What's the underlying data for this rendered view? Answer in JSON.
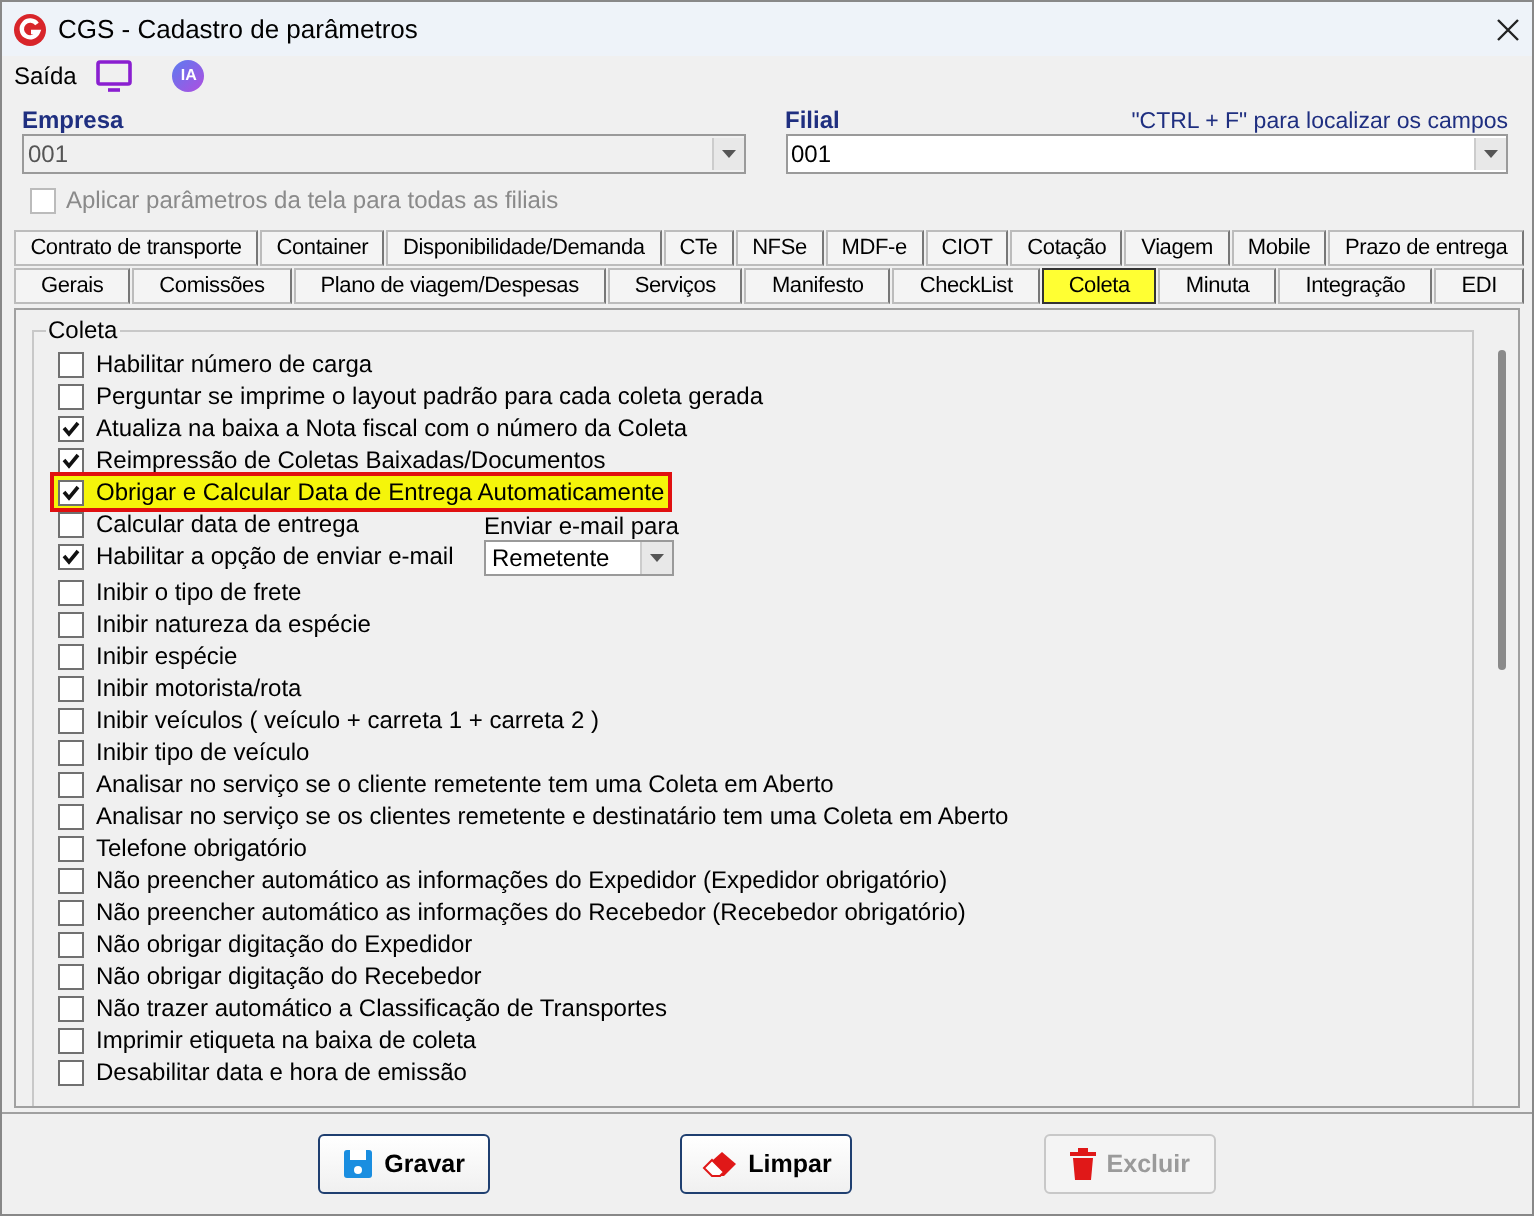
{
  "window": {
    "title": "CGS - Cadastro de parâmetros"
  },
  "toolbar": {
    "label": "Saída",
    "ia_badge": "IA"
  },
  "empresa": {
    "label": "Empresa",
    "value": "001",
    "disabled": true
  },
  "filial": {
    "label": "Filial",
    "value": "001",
    "disabled": false,
    "hint": "\"CTRL + F\" para localizar os campos"
  },
  "apply_all": {
    "label": "Aplicar parâmetros da tela para todas as filiais",
    "checked": false,
    "disabled": true
  },
  "tab_rows": [
    [
      {
        "label": "Contrato de transporte",
        "selected": false
      },
      {
        "label": "Container",
        "selected": false
      },
      {
        "label": "Disponibilidade/Demanda",
        "selected": false
      },
      {
        "label": "CTe",
        "selected": false
      },
      {
        "label": "NFSe",
        "selected": false
      },
      {
        "label": "MDF-e",
        "selected": false
      },
      {
        "label": "CIOT",
        "selected": false
      },
      {
        "label": "Cotação",
        "selected": false
      },
      {
        "label": "Viagem",
        "selected": false
      },
      {
        "label": "Mobile",
        "selected": false
      },
      {
        "label": "Prazo de entrega",
        "selected": false
      }
    ],
    [
      {
        "label": "Gerais",
        "selected": false
      },
      {
        "label": "Comissões",
        "selected": false
      },
      {
        "label": "Plano de viagem/Despesas",
        "selected": false
      },
      {
        "label": "Serviços",
        "selected": false
      },
      {
        "label": "Manifesto",
        "selected": false
      },
      {
        "label": "CheckList",
        "selected": false
      },
      {
        "label": "Coleta",
        "selected": true
      },
      {
        "label": "Minuta",
        "selected": false
      },
      {
        "label": "Integração",
        "selected": false
      },
      {
        "label": "EDI",
        "selected": false
      }
    ]
  ],
  "group": {
    "title": "Coleta",
    "options": [
      {
        "kind": "checkbox",
        "label": "Habilitar número de carga",
        "checked": false,
        "highlighted": false
      },
      {
        "kind": "checkbox",
        "label": "Perguntar se imprime o layout padrão para cada coleta gerada",
        "checked": false,
        "highlighted": false
      },
      {
        "kind": "checkbox",
        "label": "Atualiza na baixa a Nota fiscal com o número da Coleta",
        "checked": true,
        "highlighted": false
      },
      {
        "kind": "checkbox",
        "label": "Reimpressão de Coletas Baixadas/Documentos",
        "checked": true,
        "highlighted": false
      },
      {
        "kind": "checkbox",
        "label": "Obrigar e Calcular Data de Entrega Automaticamente",
        "checked": true,
        "highlighted": true
      },
      {
        "kind": "pair",
        "items": [
          {
            "label": "Calcular data de entrega",
            "checked": false,
            "highlighted": false
          },
          {
            "label": "Habilitar a opção de enviar e-mail",
            "checked": true,
            "highlighted": false
          }
        ],
        "select": {
          "label": "Enviar e-mail para",
          "value": "Remetente"
        }
      },
      {
        "kind": "checkbox",
        "label": "Inibir o tipo de frete",
        "checked": false,
        "highlighted": false
      },
      {
        "kind": "checkbox",
        "label": "Inibir natureza da espécie",
        "checked": false,
        "highlighted": false
      },
      {
        "kind": "checkbox",
        "label": "Inibir espécie",
        "checked": false,
        "highlighted": false
      },
      {
        "kind": "checkbox",
        "label": "Inibir motorista/rota",
        "checked": false,
        "highlighted": false
      },
      {
        "kind": "checkbox",
        "label": "Inibir veículos ( veículo + carreta 1 + carreta 2 )",
        "checked": false,
        "highlighted": false
      },
      {
        "kind": "checkbox",
        "label": "Inibir tipo de veículo",
        "checked": false,
        "highlighted": false
      },
      {
        "kind": "checkbox",
        "label": "Analisar no serviço se o cliente remetente tem uma Coleta em Aberto",
        "checked": false,
        "highlighted": false
      },
      {
        "kind": "checkbox",
        "label": "Analisar no serviço se os clientes remetente e destinatário tem uma Coleta em Aberto",
        "checked": false,
        "highlighted": false
      },
      {
        "kind": "checkbox",
        "label": "Telefone obrigatório",
        "checked": false,
        "highlighted": false
      },
      {
        "kind": "checkbox",
        "label": "Não preencher automático as informações do Expedidor (Expedidor obrigatório)",
        "checked": false,
        "highlighted": false
      },
      {
        "kind": "checkbox",
        "label": "Não preencher automático as informações do Recebedor (Recebedor obrigatório)",
        "checked": false,
        "highlighted": false
      },
      {
        "kind": "checkbox",
        "label": "Não obrigar digitação do Expedidor",
        "checked": false,
        "highlighted": false
      },
      {
        "kind": "checkbox",
        "label": "Não obrigar digitação do Recebedor",
        "checked": false,
        "highlighted": false
      },
      {
        "kind": "checkbox",
        "label": "Não trazer automático a Classificação de Transportes",
        "checked": false,
        "highlighted": false
      },
      {
        "kind": "checkbox",
        "label": "Imprimir etiqueta na baixa de coleta",
        "checked": false,
        "highlighted": false
      },
      {
        "kind": "checkbox",
        "label": "Desabilitar data e hora de emissão",
        "checked": false,
        "highlighted": false
      }
    ]
  },
  "buttons": [
    {
      "kind": "save",
      "label": "Gravar",
      "disabled": false
    },
    {
      "kind": "clear",
      "label": "Limpar",
      "disabled": false
    },
    {
      "kind": "delete",
      "label": "Excluir",
      "disabled": true
    }
  ]
}
